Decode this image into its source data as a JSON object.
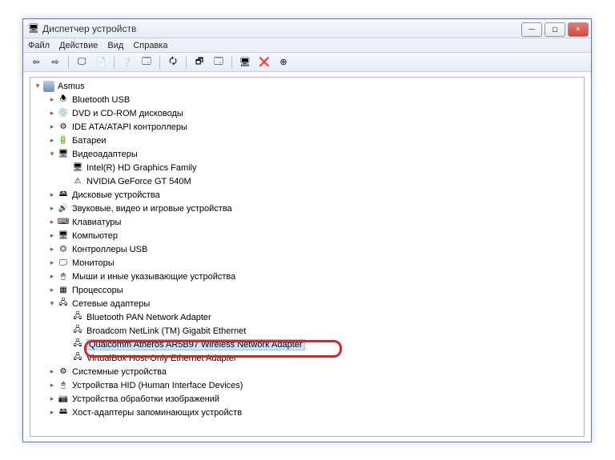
{
  "window": {
    "title": "Диспетчер устройств"
  },
  "title_controls": {
    "min": "—",
    "max": "▢",
    "close": "✕"
  },
  "menu": {
    "file": "Файл",
    "action": "Действие",
    "view": "Вид",
    "help": "Справка"
  },
  "toolbar_icons": [
    "⇦",
    "⇨",
    "|",
    "🖵",
    "📄",
    "|",
    "❔",
    "🗔",
    "|",
    "🗘",
    "|",
    "🗗",
    "🗔",
    "|",
    "🖥",
    "❌",
    "⊕"
  ],
  "root": "Asmus",
  "categories": [
    {
      "icon": "bt",
      "label": "Bluetooth USB",
      "exp": false
    },
    {
      "icon": "dvd",
      "label": "DVD и CD-ROM дисководы",
      "exp": false
    },
    {
      "icon": "ide",
      "label": "IDE ATA/ATAPI контроллеры",
      "exp": false
    },
    {
      "icon": "bat",
      "label": "Батареи",
      "exp": false
    },
    {
      "icon": "vid",
      "label": "Видеоадаптеры",
      "exp": true,
      "children": [
        {
          "icon": "vid",
          "label": "Intel(R) HD Graphics Family"
        },
        {
          "icon": "vidw",
          "label": "NVIDIA GeForce GT 540M"
        }
      ]
    },
    {
      "icon": "hdd",
      "label": "Дисковые устройства",
      "exp": false
    },
    {
      "icon": "snd",
      "label": "Звуковые, видео и игровые устройства",
      "exp": false
    },
    {
      "icon": "kb",
      "label": "Клавиатуры",
      "exp": false
    },
    {
      "icon": "pc",
      "label": "Компьютер",
      "exp": false
    },
    {
      "icon": "usb",
      "label": "Контроллеры USB",
      "exp": false
    },
    {
      "icon": "mon",
      "label": "Мониторы",
      "exp": false
    },
    {
      "icon": "ms",
      "label": "Мыши и иные указывающие устройства",
      "exp": false
    },
    {
      "icon": "cpu",
      "label": "Процессоры",
      "exp": false
    },
    {
      "icon": "net",
      "label": "Сетевые адаптеры",
      "exp": true,
      "children": [
        {
          "icon": "net",
          "label": "Bluetooth PAN Network Adapter"
        },
        {
          "icon": "net",
          "label": "Broadcom NetLink (TM) Gigabit Ethernet"
        },
        {
          "icon": "net",
          "label": "Qualcomm Atheros AR5B97 Wireless Network Adapter",
          "selected": true
        },
        {
          "icon": "net",
          "label": "VirtualBox Host-Only Ethernet Adapter"
        }
      ]
    },
    {
      "icon": "sys",
      "label": "Системные устройства",
      "exp": false
    },
    {
      "icon": "hid",
      "label": "Устройства HID (Human Interface Devices)",
      "exp": false
    },
    {
      "icon": "img",
      "label": "Устройства обработки изображений",
      "exp": false
    },
    {
      "icon": "stor",
      "label": "Хост-адаптеры запоминающих устройств",
      "exp": false
    }
  ],
  "icon_glyph": {
    "bt": "🕭",
    "dvd": "💿",
    "ide": "⚙",
    "bat": "🔋",
    "vid": "🖥",
    "vidw": "⚠",
    "hdd": "🖴",
    "snd": "🔊",
    "kb": "⌨",
    "pc": "🖥",
    "usb": "⏣",
    "mon": "🖵",
    "ms": "🖱",
    "cpu": "▦",
    "net": "🖧",
    "sys": "⚙",
    "hid": "🖰",
    "img": "📷",
    "stor": "🖴"
  }
}
